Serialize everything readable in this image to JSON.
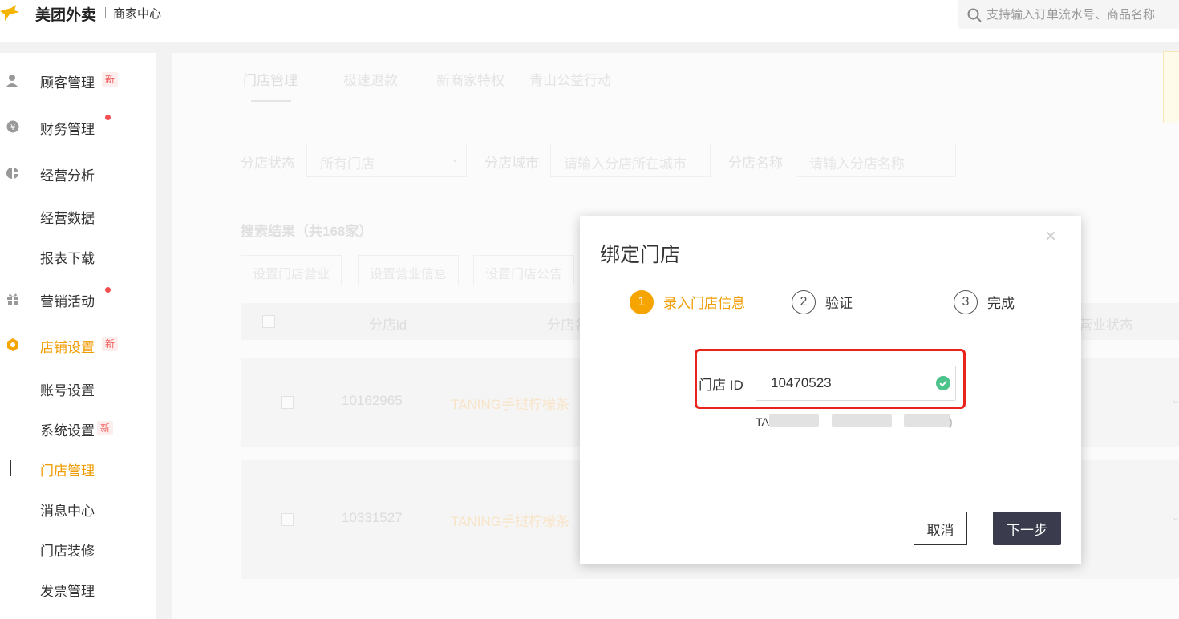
{
  "header": {
    "brand": "美团外卖",
    "subtitle": "商家中心",
    "search_placeholder": "支持输入订单流水号、商品名称"
  },
  "sidebar": {
    "groups": [
      {
        "label": "顾客管理",
        "badge": "新",
        "icon": "customer-icon"
      },
      {
        "label": "财务管理",
        "icon": "yen-icon",
        "dot": true
      },
      {
        "label": "经营分析",
        "icon": "pie-chart-icon",
        "children": [
          "经营数据",
          "报表下载"
        ]
      },
      {
        "label": "营销活动",
        "icon": "gift-icon",
        "dot": true
      },
      {
        "label": "店铺设置",
        "badge": "新",
        "icon": "shop-settings-icon",
        "active": true,
        "children": [
          "账号设置",
          "系统设置",
          "门店管理",
          "消息中心",
          "门店装修",
          "发票管理"
        ],
        "child_badge": "新",
        "current_child": "门店管理"
      }
    ]
  },
  "main": {
    "tabs": [
      "门店管理",
      "极速退款",
      "新商家特权",
      "青山公益行动"
    ],
    "filters": {
      "status_label": "分店状态",
      "status_value": "所有门店",
      "city_label": "分店城市",
      "city_placeholder": "请输入分店所在城市",
      "name_label": "分店名称",
      "name_placeholder": "请输入分店名称"
    },
    "result_title": "搜索结果（共168家）",
    "batch_buttons": [
      "设置门店营业",
      "设置营业信息",
      "设置门店公告"
    ],
    "table_headers": [
      "分店id",
      "分店名",
      "营业状态"
    ],
    "rows": [
      {
        "id": "10162965",
        "name": "TANING手挝柠檬茶"
      },
      {
        "id": "10331527",
        "name": "TANING手挝柠檬茶"
      }
    ]
  },
  "modal": {
    "title": "绑定门店",
    "close": "×",
    "steps": [
      {
        "num": "1",
        "label": "录入门店信息"
      },
      {
        "num": "2",
        "label": "验证"
      },
      {
        "num": "3",
        "label": "完成"
      }
    ],
    "field_label": "门店 ID",
    "field_value": "10470523",
    "hint_prefix": "TA",
    "hint_suffix": ")",
    "cancel": "取消",
    "next": "下一步"
  },
  "colors": {
    "accent": "#f5a400",
    "highlight_red": "#e8241c",
    "primary_button": "#3a3c4e",
    "success": "#4cc38a"
  }
}
